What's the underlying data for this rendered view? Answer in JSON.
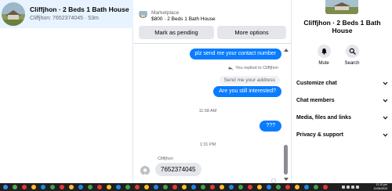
{
  "conversation_list": {
    "active": {
      "name": "Cliffjhon · 2 Beds 1 Bath House",
      "subtitle": "Cliffjhon: 7652374045 · 53m"
    }
  },
  "marketplace": {
    "label": "Marketplace",
    "listing": "$800 · 2 Beds 1 Bath House",
    "mark_pending_label": "Mark as pending",
    "more_options_label": "More options"
  },
  "messages": {
    "out_1": "plz send me your contact number",
    "replied_note": "You replied to Cliffjhon",
    "quoted": "Send me your address",
    "out_2": "Are you still interested?",
    "time_1": "11:58 AM",
    "out_3": "???",
    "time_2": "1:31 PM",
    "sender_name": "Cliffjhon",
    "in_1": "7652374045"
  },
  "details": {
    "name": "Cliffjhon · 2 Beds 1 Bath House",
    "actions": {
      "mute": "Mute",
      "search": "Search"
    },
    "menu": [
      {
        "label": "Customize chat"
      },
      {
        "label": "Chat members"
      },
      {
        "label": "Media, files and links"
      },
      {
        "label": "Privacy & support"
      }
    ]
  },
  "taskbar": {
    "time": "12:10 pm",
    "date": "12/06/2023"
  },
  "colors": {
    "accent": "#0a7cff",
    "active_row": "#e7f3ff",
    "button_bg": "#e4e6eb",
    "taskbar": "#1f1f1f"
  }
}
